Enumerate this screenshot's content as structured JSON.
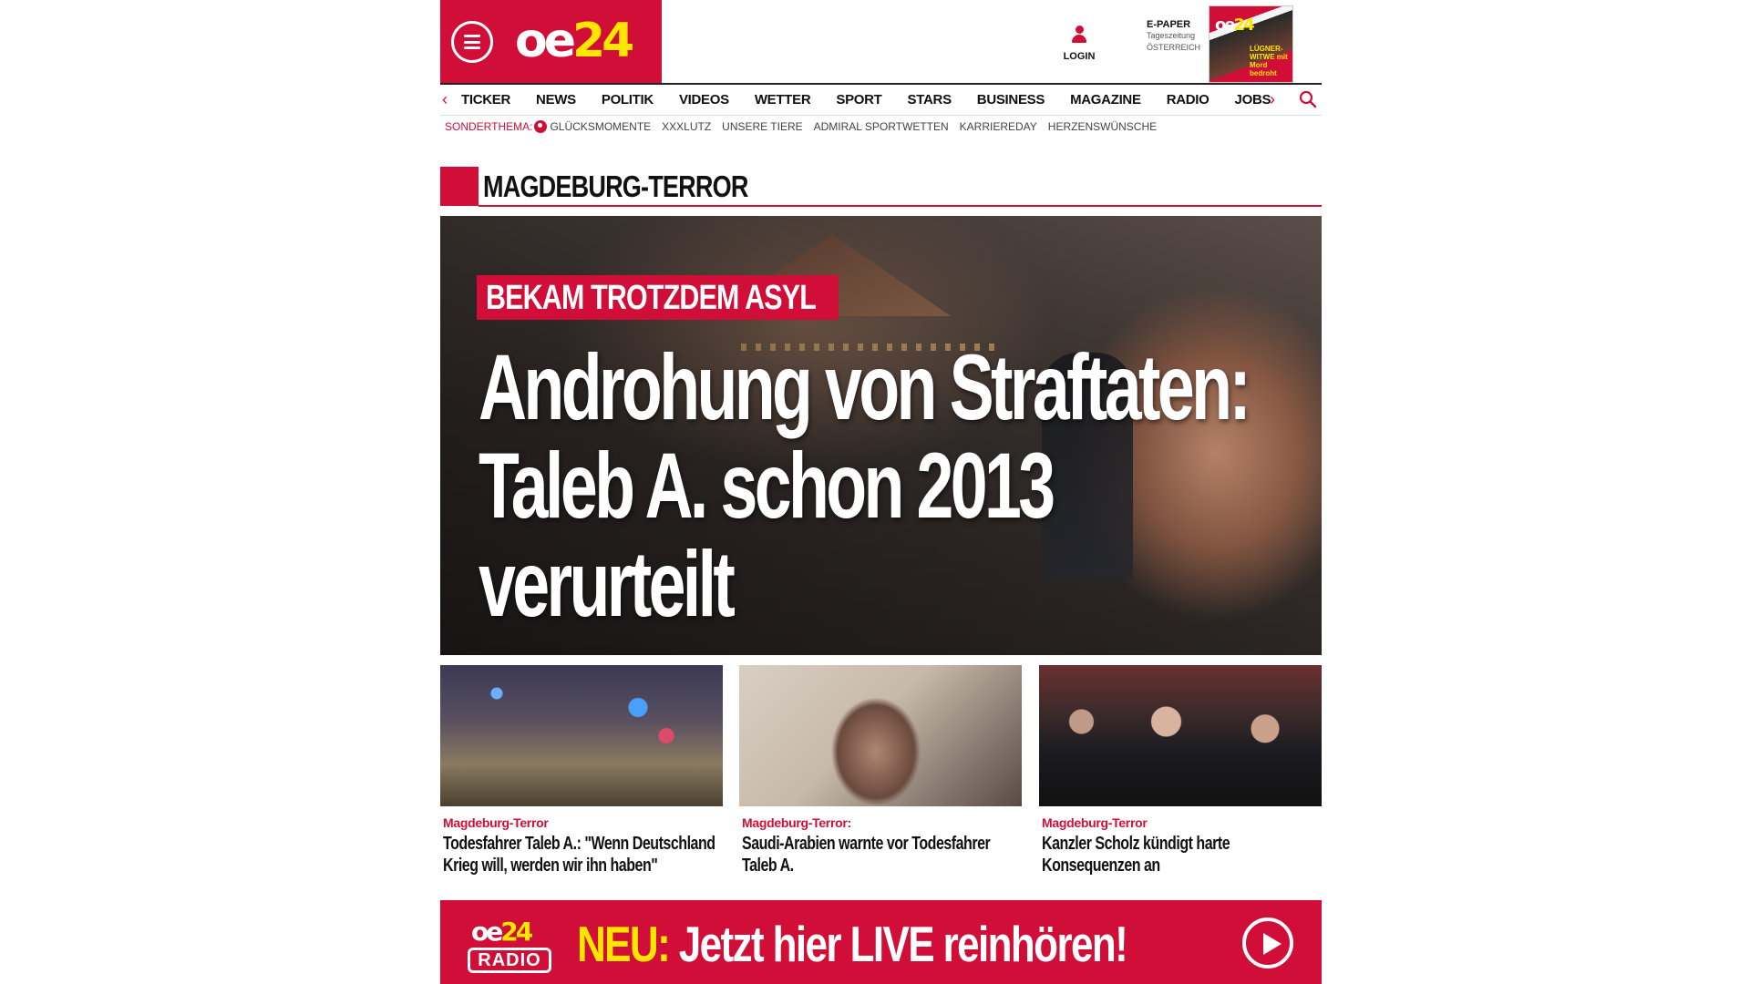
{
  "header": {
    "logo": {
      "part1": "oe",
      "part2": "24"
    },
    "login_label": "LOGIN",
    "epaper": {
      "title": "E-PAPER",
      "subtitle_1": "Tageszeitung",
      "subtitle_2": "ÖSTERREICH"
    },
    "epaper_cover": {
      "logo_1": "oe",
      "logo_2": "24",
      "headline": "LÜGNER-WITWE mit Mord bedroht"
    }
  },
  "nav": {
    "items": [
      "TICKER",
      "NEWS",
      "POLITIK",
      "VIDEOS",
      "WETTER",
      "SPORT",
      "STARS",
      "BUSINESS",
      "MAGAZINE",
      "RADIO",
      "JOBS"
    ],
    "prev_arrow": "‹",
    "next_arrow": "›"
  },
  "subnav": {
    "label": "SONDERTHEMA:",
    "items": [
      "GLÜCKSMOMENTE",
      "XXXLUTZ",
      "UNSERE TIERE",
      "ADMIRAL SPORTWETTEN",
      "KARRIEREDAY",
      "HERZENSWÜNSCHE"
    ]
  },
  "section": {
    "title": "MAGDEBURG-TERROR"
  },
  "hero": {
    "kicker": "BEKAM TROTZDEM ASYL",
    "headline": "Androhung von Straftaten: Taleb A. schon 2013 verurteilt"
  },
  "teasers": [
    {
      "kicker": "Magdeburg-Terror",
      "title": "Todesfahrer Taleb A.: \"Wenn Deutschland Krieg will, werden wir ihn haben\""
    },
    {
      "kicker": "Magdeburg-Terror:",
      "title": "Saudi-Arabien warnte vor Todesfahrer Taleb A."
    },
    {
      "kicker": "Magdeburg-Terror",
      "title": "Kanzler Scholz kündigt harte Konsequenzen an"
    }
  ],
  "radio_banner": {
    "logo_1": "oe",
    "logo_2": "24",
    "logo_radio": "RADIO",
    "neu": "NEU:",
    "text": " Jetzt hier LIVE reinhören!"
  },
  "colors": {
    "brand_red": "#d10e37",
    "brand_yellow": "#ffe600"
  },
  "icons": {
    "menu": "hamburger-icon",
    "login": "user-icon",
    "search": "search-icon",
    "play": "play-icon"
  }
}
